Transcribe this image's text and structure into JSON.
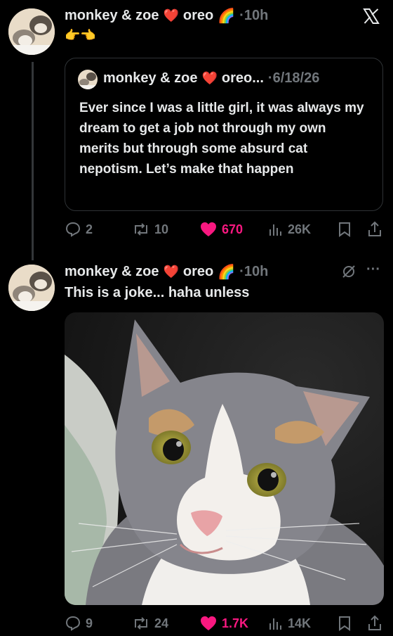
{
  "tweet1": {
    "name": "monkey & zoe",
    "name2": "oreo",
    "time": "·10h",
    "emoji_line": "👉👈",
    "close_icon": "x-logo-icon",
    "quote": {
      "name": "monkey & zoe",
      "name2": "oreo...",
      "date": "·6/18/26",
      "text": "Ever since I was a little girl, it was always my dream to get a job not through my own merits but through some absurd cat nepotism. Let’s make that happen"
    },
    "actions": {
      "replies": "2",
      "reposts": "10",
      "likes": "670",
      "views": "26K"
    }
  },
  "tweet2": {
    "name": "monkey & zoe",
    "name2": "oreo",
    "time": "·10h",
    "text": "This is a joke... haha unless",
    "more": "···",
    "actions": {
      "replies": "9",
      "reposts": "24",
      "likes": "1.7K",
      "views": "14K"
    }
  },
  "colors": {
    "like": "#f91880",
    "muted": "#71767b",
    "background": "#000000"
  }
}
